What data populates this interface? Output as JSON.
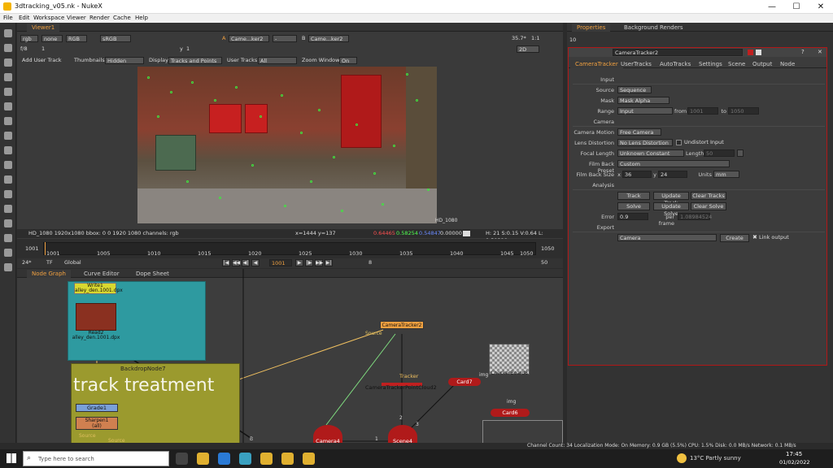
{
  "window": {
    "title": "3dtracking_v05.nk - NukeX",
    "minimize": "—",
    "maximize": "☐",
    "close": "✕"
  },
  "menu": [
    "File",
    "Edit",
    "Workspace",
    "Viewer",
    "Render",
    "Cache",
    "Help"
  ],
  "viewer": {
    "tab": "Viewer1",
    "channels": "rgb",
    "alpha": "none",
    "color": "RGB",
    "lut": "sRGB",
    "input_a": "Came...ker2",
    "input_a_sep": "-",
    "input_b": "Came...ker2",
    "fstop": "f/8",
    "frame_step": "1",
    "y_label": "y",
    "y_value": "1",
    "zoom": "35.7*",
    "ratio": "1:1",
    "view_mode": "2D",
    "add_user_track": "Add User Track",
    "thumbnails_label": "Thumbnails",
    "thumbnails_value": "Hidden",
    "display_label": "Display",
    "display_value": "Tracks and Points",
    "user_tracks_label": "User Tracks",
    "user_tracks_value": "All",
    "zoom_window_label": "Zoom Window",
    "zoom_window_value": "On",
    "format_label": "HD_1080",
    "info_left": "HD_1080 1920x1080  bbox: 0 0 1920 1080 channels: rgb",
    "info_coords": "x=1444 y=137",
    "info_r": "0.64465",
    "info_g": "0.58254",
    "info_b": "0.54847",
    "info_a": "0.00000",
    "info_hsv": "H: 21 S:0.15 V:0.64  L: 0.59328"
  },
  "timeline": {
    "start": "1001",
    "end": "1050",
    "ticks": [
      "1001",
      "1005",
      "1010",
      "1015",
      "1020",
      "1025",
      "1030",
      "1035",
      "1040",
      "1045",
      "1050"
    ],
    "current": "1001",
    "fps": "24*",
    "tf": "TF",
    "scope": "Global",
    "step": "8",
    "end_field": "50"
  },
  "node_tabs": [
    "Node Graph",
    "Curve Editor",
    "Dope Sheet"
  ],
  "nodes": {
    "write": "Write1",
    "write_file": "alley_den.1001.dpx",
    "read": "Read2",
    "read_file": "alley_den.1001.dpx",
    "backdrop": "BackdropNode7",
    "backdrop_text": "track treatment",
    "grade": "Grade1",
    "sharpen": "Sharpen1",
    "sharpen_sub": "(all)",
    "source_a": "Source",
    "source_b": "Source",
    "cameratracker": "CameraTracker2",
    "ct_source": "Source",
    "tracker_label": "Tracker",
    "pointcloud": "CameraTrackerPointCloud2",
    "card7": "Card7",
    "card6": "Card6",
    "checker": "CheckerBoard8",
    "img_a": "img",
    "img_b": "img",
    "camera4": "Camera4",
    "scene4": "Scene4",
    "pin1": "1",
    "pin2": "2",
    "pin3": "3",
    "pinB": "B"
  },
  "properties": {
    "tab_props": "Properties",
    "tab_bg": "Background Renders",
    "max_panels": "10",
    "node_name": "CameraTracker2",
    "tabs": [
      "CameraTracker",
      "UserTracks",
      "AutoTracks",
      "Settings",
      "Scene",
      "Output",
      "Node"
    ],
    "input_header": "Input",
    "source_label": "Source",
    "source_value": "Sequence",
    "mask_label": "Mask",
    "mask_value": "Mask Alpha",
    "range_label": "Range",
    "range_value": "Input",
    "range_from_label": "from",
    "range_from": "1001",
    "range_to_label": "to",
    "range_to": "1050",
    "camera_header": "Camera",
    "motion_label": "Camera Motion",
    "motion_value": "Free Camera",
    "lens_label": "Lens Distortion",
    "lens_value": "No Lens Distortion",
    "undistort_label": "Undistort Input",
    "focal_label": "Focal Length",
    "focal_value": "Unknown Constant",
    "length_label": "Length",
    "length_value": "50",
    "filmback_label": "Film Back Preset",
    "filmback_value": "Custom",
    "fbsize_label": "Film Back Size",
    "fbsize_x_label": "x",
    "fbsize_x": "36",
    "fbsize_y_label": "y",
    "fbsize_y": "24",
    "units_label": "Units",
    "units_value": "mm",
    "analysis_header": "Analysis",
    "btn_track": "Track",
    "btn_update_track": "Update Track",
    "btn_clear_tracks": "Clear Tracks",
    "btn_solve": "Solve",
    "btn_update_solve": "Update Solve",
    "btn_clear_solve": "Clear Solve",
    "error_label": "Error",
    "error_value": "0.9",
    "perframe_label": "per frame",
    "perframe_value": "1.08984524",
    "export_header": "Export",
    "export_value": "Camera",
    "btn_create": "Create",
    "link_output": "Link output"
  },
  "status": "Channel Count: 34  Localization Mode: On  Memory: 0.9 GB (5.5%)  CPU: 1.5%  Disk: 0.0 MB/s  Network: 0.1 MB/s",
  "taskbar": {
    "search_placeholder": "Type here to search",
    "weather": "13°C  Partly sunny",
    "time": "17:45",
    "date": "01/02/2022"
  },
  "colors": {
    "accent": "#f0a040",
    "panel_border": "#b01818",
    "track_points": "#3ee83e"
  }
}
